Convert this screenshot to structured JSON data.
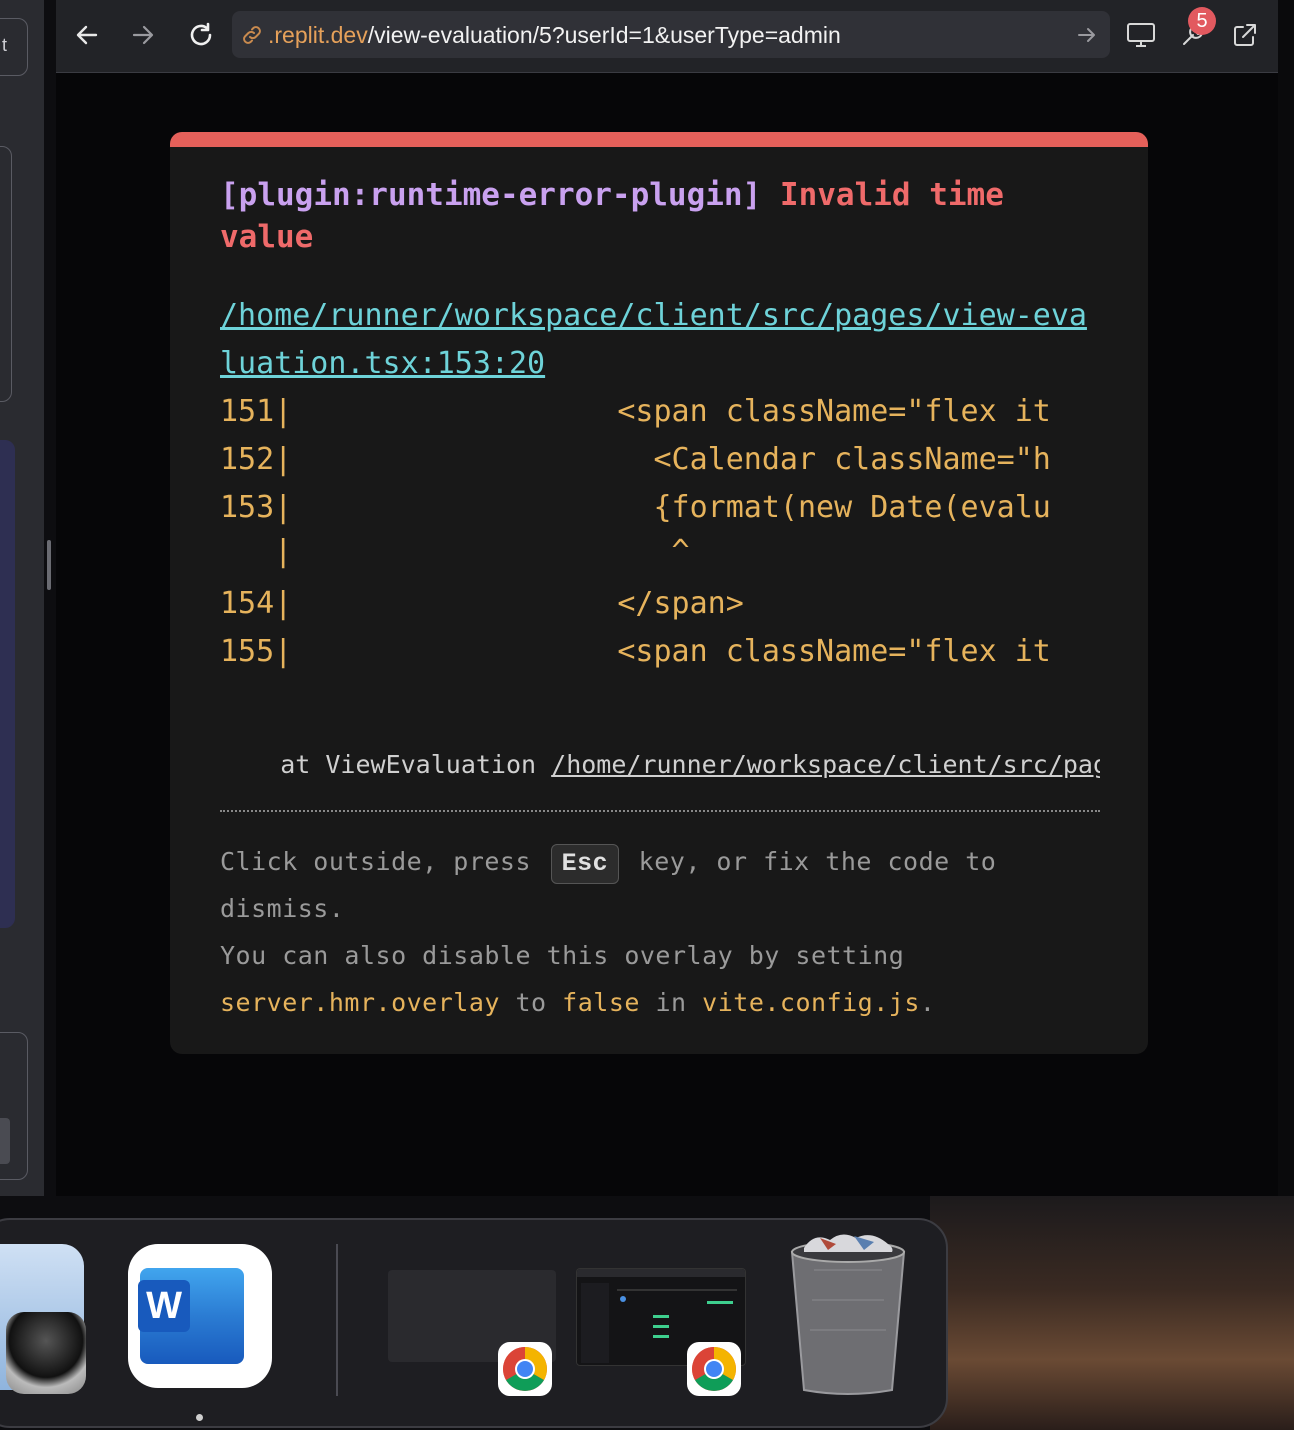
{
  "sidebar": {
    "button_text": "t"
  },
  "browser": {
    "url_host": ".replit.dev",
    "url_path": "/view-evaluation/5?userId=1&userType=admin",
    "devtools_badge": "5"
  },
  "overlay": {
    "plugin": "[plugin:runtime-error-plugin]",
    "error_message": "Invalid time value",
    "file_link": "/home/runner/workspace/client/src/pages/view-evaluation.tsx:153:20",
    "frame_lines": [
      "151|                  <span className=\"flex it",
      "152|                    <Calendar className=\"h",
      "153|                    {format(new Date(evalu",
      "   |                     ^",
      "154|                  </span>",
      "155|                  <span className=\"flex it"
    ],
    "stack_prefix": "    at ViewEvaluation ",
    "stack_path": "/home/runner/workspace/client/src/pages/view-evaluation.tsx",
    "tip": {
      "line1_a": "Click outside, press",
      "esc": "Esc",
      "line1_b": "key, or fix the code to dismiss.",
      "line2_a": "You can also disable this overlay by setting",
      "code1": "server.hmr.overlay",
      "to": "to",
      "code2": "false",
      "in": "in",
      "code3": "vite.config.js",
      "period": "."
    }
  },
  "dock": {
    "apps": [
      {
        "icon": "preview-icon",
        "running": false
      },
      {
        "icon": "word-icon",
        "label": "W",
        "running": true
      },
      {
        "icon": "chrome-window-thumbnail",
        "running": false
      },
      {
        "icon": "chrome-window-thumbnail",
        "running": false
      },
      {
        "icon": "trash-icon",
        "running": false
      }
    ]
  },
  "colors": {
    "error_bar": "#e5605a",
    "plugin_text": "#c9a1ef",
    "error_text": "#ef6a6a",
    "file_link": "#6ed3d9",
    "code_text": "#e6b35c",
    "url_host": "#e6a15a",
    "badge": "#e2595f"
  }
}
